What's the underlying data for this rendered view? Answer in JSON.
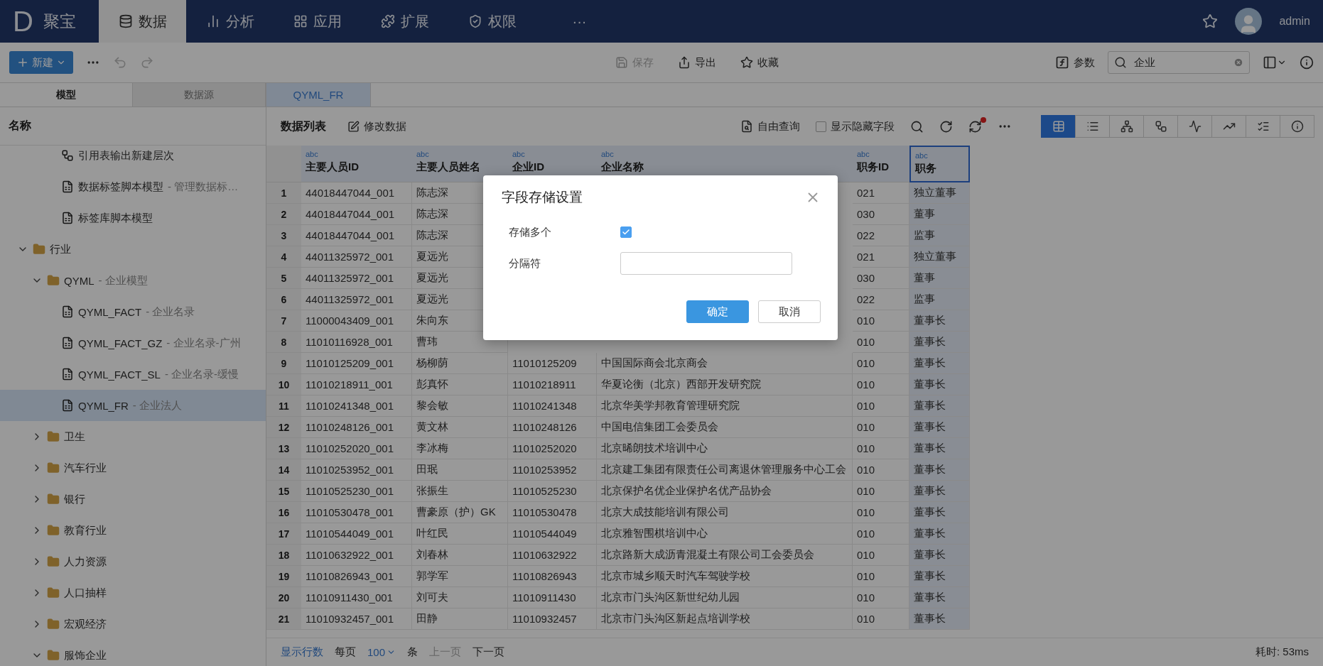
{
  "nav": {
    "logo_letter": "D",
    "brand": "聚宝",
    "tabs": [
      {
        "label": "数据",
        "selected": true
      },
      {
        "label": "分析",
        "selected": false
      },
      {
        "label": "应用",
        "selected": false
      },
      {
        "label": "扩展",
        "selected": false
      },
      {
        "label": "权限",
        "selected": false
      },
      {
        "label": "···",
        "selected": false
      }
    ],
    "user": "admin"
  },
  "toolbar": {
    "new_button": "新建",
    "undo_disabled": true,
    "redo_disabled": true,
    "save": {
      "label": "保存",
      "disabled": true
    },
    "export": "导出",
    "favorite": "收藏",
    "params": "参数",
    "search": {
      "value": "企业"
    }
  },
  "side_tabs": [
    {
      "label": "模型",
      "selected": true
    },
    {
      "label": "数据源",
      "selected": false
    }
  ],
  "doc_tabs": [
    {
      "label": "QYML_FR",
      "selected": true
    }
  ],
  "tree": {
    "heading": "名称",
    "items": [
      {
        "children": [
          {
            "children": [
              {
                "kind": "hierarchy",
                "name": "引用表输出新建层次",
                "selected": false
              },
              {
                "kind": "table",
                "name": "数据标签脚本模型",
                "description": "- 管理数据标…",
                "selected": false
              },
              {
                "kind": "table",
                "name": "标签库脚本模型",
                "selected": false
              }
            ]
          }
        ]
      },
      {
        "kind": "folder",
        "name": "行业",
        "expanded": true,
        "selected": false,
        "children": [
          {
            "kind": "folder",
            "name": "QYML",
            "description": "- 企业模型",
            "expanded": true,
            "selected": false,
            "children": [
              {
                "kind": "table",
                "name": "QYML_FACT",
                "description": "- 企业名录",
                "selected": false
              },
              {
                "kind": "table",
                "name": "QYML_FACT_GZ",
                "description": "- 企业名录-广州",
                "selected": false
              },
              {
                "kind": "table",
                "name": "QYML_FACT_SL",
                "description": "- 企业名录-缓慢",
                "selected": false
              },
              {
                "kind": "table",
                "name": "QYML_FR",
                "description": "- 企业法人",
                "selected": true
              }
            ]
          },
          {
            "kind": "folder",
            "name": "卫生",
            "expanded": false,
            "selected": false
          },
          {
            "kind": "folder",
            "name": "汽车行业",
            "expanded": false,
            "selected": false
          },
          {
            "kind": "folder",
            "name": "银行",
            "expanded": false,
            "selected": false
          },
          {
            "kind": "folder",
            "name": "教育行业",
            "expanded": false,
            "selected": false
          },
          {
            "kind": "folder",
            "name": "人力资源",
            "expanded": false,
            "selected": false
          },
          {
            "kind": "folder",
            "name": "人口抽样",
            "expanded": false,
            "selected": false
          },
          {
            "kind": "folder",
            "name": "宏观经济",
            "expanded": false,
            "selected": false
          },
          {
            "kind": "folder",
            "name": "服饰企业",
            "expanded": true,
            "selected": false
          }
        ]
      }
    ]
  },
  "panel": {
    "title": "数据列表",
    "edit": "修改数据",
    "free_query": "自由查询",
    "show_hidden": {
      "label": "显示隐藏字段",
      "checked": false
    },
    "sync_alert": true,
    "views": [
      {
        "selected": true
      },
      {
        "selected": false
      },
      {
        "selected": false
      },
      {
        "selected": false
      },
      {
        "selected": false
      },
      {
        "selected": false
      },
      {
        "selected": false
      },
      {
        "selected": false
      }
    ]
  },
  "table": {
    "columns": [
      {
        "type": "abc",
        "label": "主要人员ID",
        "selected": false
      },
      {
        "type": "abc",
        "label": "主要人员姓名",
        "selected": false
      },
      {
        "type": "abc",
        "label": "企业ID",
        "selected": false
      },
      {
        "type": "abc",
        "label": "企业名称",
        "selected": false
      },
      {
        "type": "abc",
        "label": "职务ID",
        "selected": false
      },
      {
        "type": "abc",
        "label": "职务",
        "selected": true
      }
    ],
    "rows": [
      {
        "index": "1",
        "cells": [
          "44018447044_001",
          "陈志深",
          null,
          null,
          "021",
          "独立董事"
        ]
      },
      {
        "index": "2",
        "cells": [
          "44018447044_001",
          "陈志深",
          null,
          null,
          "030",
          "董事"
        ]
      },
      {
        "index": "3",
        "cells": [
          "44018447044_001",
          "陈志深",
          null,
          null,
          "022",
          "监事"
        ]
      },
      {
        "index": "4",
        "cells": [
          "44011325972_001",
          "夏远光",
          null,
          null,
          "021",
          "独立董事"
        ]
      },
      {
        "index": "5",
        "cells": [
          "44011325972_001",
          "夏远光",
          null,
          null,
          "030",
          "董事"
        ]
      },
      {
        "index": "6",
        "cells": [
          "44011325972_001",
          "夏远光",
          null,
          null,
          "022",
          "监事"
        ]
      },
      {
        "index": "7",
        "cells": [
          "11000043409_001",
          "朱向东",
          null,
          null,
          "010",
          "董事长"
        ]
      },
      {
        "index": "8",
        "cells": [
          "11010116928_001",
          "曹玮",
          null,
          null,
          "010",
          "董事长"
        ]
      },
      {
        "index": "9",
        "cells": [
          "11010125209_001",
          "杨柳荫",
          "11010125209",
          "中国国际商会北京商会",
          "010",
          "董事长"
        ]
      },
      {
        "index": "10",
        "cells": [
          "11010218911_001",
          "彭真怀",
          "11010218911",
          "华夏论衡（北京）西部开发研究院",
          "010",
          "董事长"
        ]
      },
      {
        "index": "11",
        "cells": [
          "11010241348_001",
          "黎会敏",
          "11010241348",
          "北京华美学邦教育管理研究院",
          "010",
          "董事长"
        ]
      },
      {
        "index": "12",
        "cells": [
          "11010248126_001",
          "黄文林",
          "11010248126",
          "中国电信集团工会委员会",
          "010",
          "董事长"
        ]
      },
      {
        "index": "13",
        "cells": [
          "11010252020_001",
          "李冰梅",
          "11010252020",
          "北京晞朗技术培训中心",
          "010",
          "董事长"
        ]
      },
      {
        "index": "14",
        "cells": [
          "11010253952_001",
          "田珉",
          "11010253952",
          "北京建工集团有限责任公司离退休管理服务中心工会",
          "010",
          "董事长"
        ]
      },
      {
        "index": "15",
        "cells": [
          "11010525230_001",
          "张振生",
          "11010525230",
          "北京保护名优企业保护名优产品协会",
          "010",
          "董事长"
        ]
      },
      {
        "index": "16",
        "cells": [
          "11010530478_001",
          "曹豪原（护）GK",
          "11010530478",
          "北京大成技能培训有限公司",
          "010",
          "董事长"
        ]
      },
      {
        "index": "17",
        "cells": [
          "11010544049_001",
          "叶红民",
          "11010544049",
          "北京雅智围棋培训中心",
          "010",
          "董事长"
        ]
      },
      {
        "index": "18",
        "cells": [
          "11010632922_001",
          "刘春林",
          "11010632922",
          "北京路新大成沥青混凝土有限公司工会委员会",
          "010",
          "董事长"
        ]
      },
      {
        "index": "19",
        "cells": [
          "11010826943_001",
          "郭学军",
          "11010826943",
          "北京市城乡顺天时汽车驾驶学校",
          "010",
          "董事长"
        ]
      },
      {
        "index": "20",
        "cells": [
          "11010911430_001",
          "刘可夫",
          "11010911430",
          "北京市门头沟区新世纪幼儿园",
          "010",
          "董事长"
        ]
      },
      {
        "index": "21",
        "cells": [
          "11010932457_001",
          "田静",
          "11010932457",
          "北京市门头沟区新起点培训学校",
          "010",
          "董事长"
        ]
      }
    ]
  },
  "footer": {
    "rows_link": "显示行数",
    "per_page": "每页",
    "page_size": "100",
    "unit": "条",
    "prev": {
      "label": "上一页",
      "disabled": true
    },
    "next": {
      "label": "下一页",
      "disabled": false
    },
    "elapsed": "耗时: 53ms"
  },
  "dialog": {
    "title": "字段存储设置",
    "fields": [
      {
        "kind": "checkbox",
        "label": "存储多个",
        "checked": true
      },
      {
        "kind": "text",
        "label": "分隔符"
      }
    ],
    "buttons": [
      {
        "label": "确定",
        "kind": "primary"
      },
      {
        "label": "取消",
        "kind": "default"
      }
    ]
  }
}
